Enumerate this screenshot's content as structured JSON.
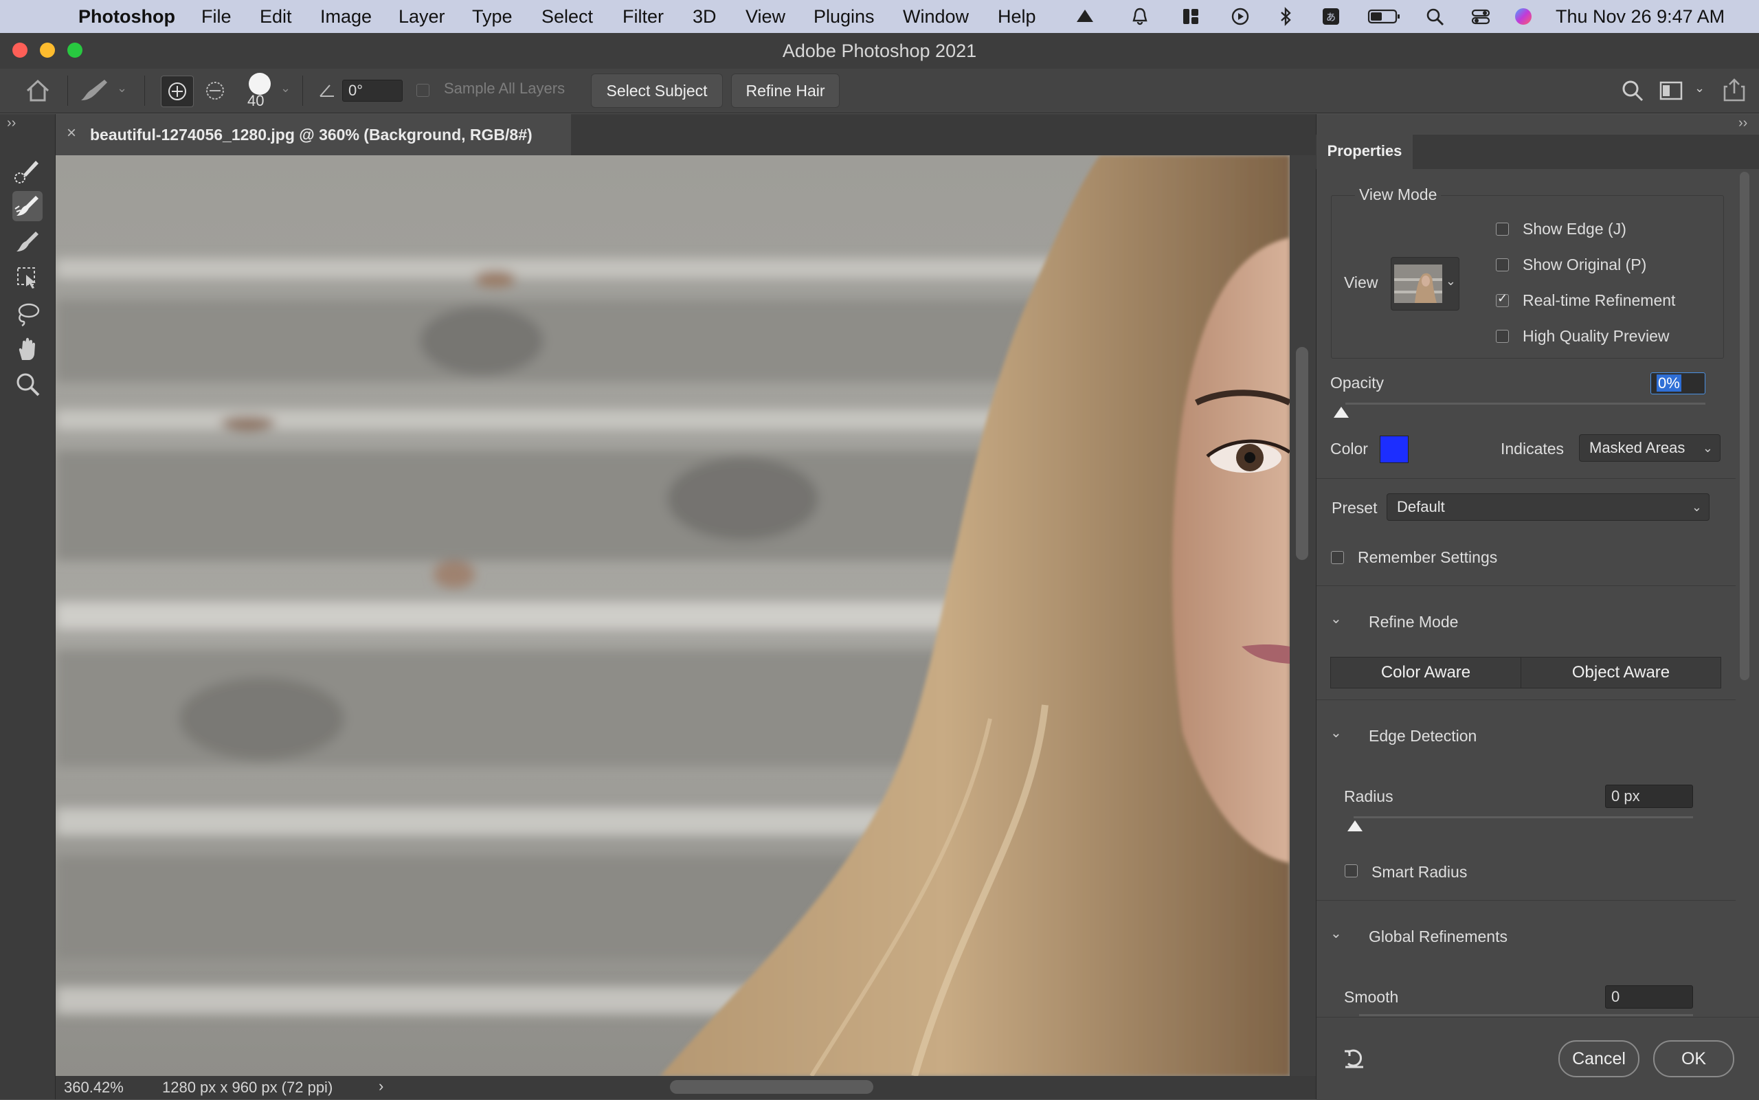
{
  "menubar": {
    "app_name": "Photoshop",
    "items": [
      "File",
      "Edit",
      "Image",
      "Layer",
      "Type",
      "Select",
      "Filter",
      "3D",
      "View",
      "Plugins",
      "Window",
      "Help"
    ],
    "clock": "Thu Nov 26  9:47 AM"
  },
  "window": {
    "title": "Adobe Photoshop 2021"
  },
  "options": {
    "brush_size": "40",
    "angle": "0°",
    "sample_all_layers": "Sample All Layers",
    "select_subject": "Select Subject",
    "refine_hair": "Refine Hair"
  },
  "tools": [
    "quick-selection-tool",
    "refine-edge-brush-tool",
    "brush-tool",
    "object-selection-tool",
    "lasso-tool",
    "hand-tool",
    "zoom-tool"
  ],
  "document": {
    "tab_title": "beautiful-1274056_1280.jpg @ 360% (Background, RGB/8#)",
    "zoom": "360.42%",
    "size_info": "1280 px x 960 px (72 ppi)"
  },
  "properties": {
    "tab": "Properties",
    "view_mode": {
      "heading": "View Mode",
      "view_label": "View",
      "show_edge": "Show Edge (J)",
      "show_original": "Show Original (P)",
      "realtime": "Real-time Refinement",
      "hq_preview": "High Quality Preview",
      "realtime_checked": true
    },
    "opacity_label": "Opacity",
    "opacity_value": "0%",
    "color_label": "Color",
    "overlay_color": "#1c2eff",
    "indicates_label": "Indicates",
    "indicates_value": "Masked Areas",
    "preset_label": "Preset",
    "preset_value": "Default",
    "remember": "Remember Settings",
    "refine_mode": {
      "heading": "Refine Mode",
      "color_aware": "Color Aware",
      "object_aware": "Object Aware"
    },
    "edge_detection": {
      "heading": "Edge Detection",
      "radius_label": "Radius",
      "radius_value": "0 px",
      "smart_radius": "Smart Radius"
    },
    "global": {
      "heading": "Global Refinements",
      "smooth_label": "Smooth",
      "smooth_value": "0"
    },
    "cancel": "Cancel",
    "ok": "OK"
  }
}
